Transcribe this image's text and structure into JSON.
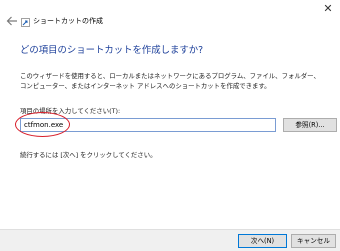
{
  "window": {
    "close_glyph": "✕",
    "back_icon": "arrow-left-icon",
    "wizard_icon": "shortcut-icon",
    "title": "ショートカットの作成"
  },
  "main": {
    "heading": "どの項目のショートカットを作成しますか?",
    "description": "このウィザードを使用すると、ローカルまたはネットワークにあるプログラム、ファイル、フォルダー、コンピューター、またはインターネット アドレスへのショートカットを作成できます。",
    "field_label": "項目の場所を入力してください(T):",
    "location_value": "ctfmon.exe",
    "browse_label": "参照(R)...",
    "hint": "続行するには [次へ] をクリックしてください。"
  },
  "annotation": {
    "highlight_color": "#d81e2a"
  },
  "footer": {
    "next_label": "次へ(N)",
    "cancel_label": "キャンセル"
  },
  "colors": {
    "heading": "#1c3f9a",
    "input_border": "#7a9cd3",
    "primary_button_border": "#0078d7"
  }
}
